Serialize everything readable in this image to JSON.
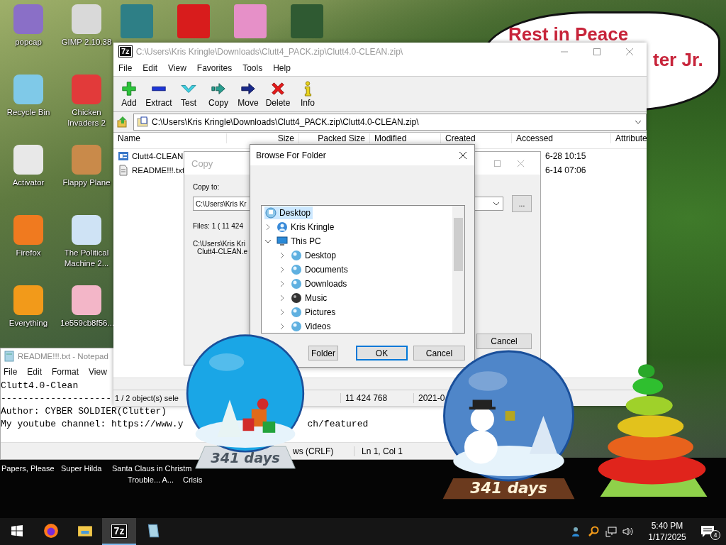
{
  "desktop_icons": [
    {
      "label": "popcap"
    },
    {
      "label": "GIMP 2.10.38"
    },
    {
      "label": "Recycle Bin"
    },
    {
      "label": "Chicken Invaders 2"
    },
    {
      "label": "Activator"
    },
    {
      "label": "Flappy Plane"
    },
    {
      "label": "Firefox"
    },
    {
      "label": "The Political Machine 2..."
    },
    {
      "label": "Everything"
    },
    {
      "label": "1e559cb8f56..."
    }
  ],
  "wallpaper_bubble": {
    "lines": [
      "Rest in Peace",
      "ter Jr."
    ]
  },
  "notepad": {
    "title": "README!!!.txt - Notepad",
    "menu": [
      "File",
      "Edit",
      "Format",
      "View"
    ],
    "lines": [
      [
        "Clutt4.0-Clean"
      ],
      [
        "--------------------"
      ],
      [
        "Author: CYBER SOLDIER(Clutter)"
      ],
      [
        "My youtube channel: https://www.y",
        "ch/featured"
      ]
    ],
    "status": [
      "ws (CRLF)",
      "Ln 1, Col 1"
    ]
  },
  "archive_window": {
    "icon_text": "7z",
    "title": "C:\\Users\\Kris Kringle\\Downloads\\Clutt4_PACK.zip\\Clutt4.0-CLEAN.zip\\",
    "menu": [
      "File",
      "Edit",
      "View",
      "Favorites",
      "Tools",
      "Help"
    ],
    "toolbar": [
      {
        "kind": "add",
        "label": "Add"
      },
      {
        "kind": "extract",
        "label": "Extract"
      },
      {
        "kind": "test",
        "label": "Test"
      },
      {
        "kind": "copy",
        "label": "Copy"
      },
      {
        "kind": "move",
        "label": "Move"
      },
      {
        "kind": "delete",
        "label": "Delete"
      },
      {
        "kind": "info",
        "label": "Info"
      }
    ],
    "address": "C:\\Users\\Kris Kringle\\Downloads\\Clutt4_PACK.zip\\Clutt4.0-CLEAN.zip\\",
    "columns": [
      "Name",
      "Size",
      "Packed Size",
      "Modified",
      "Created",
      "Accessed",
      "Attribute"
    ],
    "rows": [
      {
        "kind": "archive",
        "name": "Clutt4-CLEAN",
        "accessed": "6-28 10:15"
      },
      {
        "kind": "text",
        "name": "README!!!.txt",
        "accessed": "6-14 07:06"
      }
    ],
    "status": [
      "1 / 2 object(s) sele",
      "11 424 768",
      "2021-0"
    ]
  },
  "copy_dialog": {
    "title": "Copy",
    "copy_to_label": "Copy to:",
    "path_field": "C:\\Users\\Kris Kr",
    "browse_button": "...",
    "files_info": "Files: 1    ( 11 424",
    "source_lines": [
      "C:\\Users\\Kris Kri",
      "Clutt4-CLEAN.e"
    ],
    "cancel_button": "Cancel"
  },
  "browse_dialog": {
    "title": "Browse For Folder",
    "tree": [
      {
        "kind": "desktop",
        "label": "Desktop",
        "selected": true,
        "children": [
          {
            "kind": "user",
            "label": "Kris Kringle",
            "selected": false,
            "expanded": false
          },
          {
            "kind": "pc",
            "label": "This PC",
            "selected": false,
            "expanded": true,
            "children": [
              {
                "kind": "folder",
                "label": "Desktop",
                "selected": false,
                "expanded": false
              },
              {
                "kind": "folder",
                "label": "Documents",
                "selected": false,
                "expanded": false
              },
              {
                "kind": "folder",
                "label": "Downloads",
                "selected": false,
                "expanded": false
              },
              {
                "kind": "music",
                "label": "Music",
                "selected": false,
                "expanded": false
              },
              {
                "kind": "folder",
                "label": "Pictures",
                "selected": false,
                "expanded": false
              },
              {
                "kind": "folder",
                "label": "Videos",
                "selected": false,
                "expanded": false
              }
            ]
          }
        ]
      }
    ],
    "buttons": [
      {
        "kind": "new_folder",
        "label": "Folder"
      },
      {
        "kind": "ok",
        "label": "OK"
      },
      {
        "kind": "cancel",
        "label": "Cancel"
      }
    ]
  },
  "snow_globes": [
    {
      "kind": "tree",
      "label": "341 days"
    },
    {
      "kind": "snowman",
      "label": "341 days"
    }
  ],
  "bottom_desktop_labels": [
    {
      "lines": [
        "Papers, Please"
      ]
    },
    {
      "lines": [
        "Super Hilda"
      ]
    },
    {
      "lines": [
        "Santa Claus in Christm",
        "Trouble... A..."
      ]
    },
    {
      "lines": [
        "Crisis"
      ]
    }
  ],
  "taskbar": {
    "apps": [
      {
        "kind": "firefox",
        "active": false
      },
      {
        "kind": "explorer",
        "active": false
      },
      {
        "kind": "sevenzip",
        "active": true,
        "icon_text": "7z"
      },
      {
        "kind": "notepad",
        "active": false
      }
    ],
    "time": "5:40 PM",
    "date": "1/17/2025",
    "notifications": "4"
  }
}
